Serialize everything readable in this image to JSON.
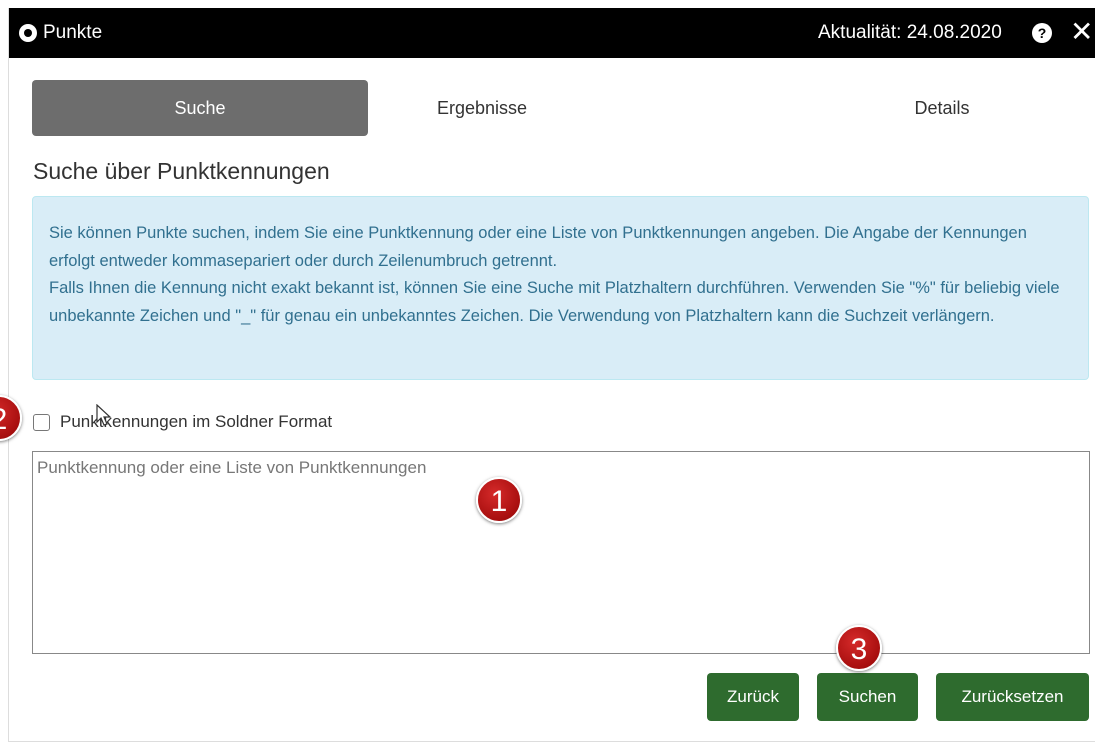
{
  "window": {
    "title": "Punkte",
    "aktualitaet": "Aktualität: 24.08.2020",
    "help_icon": "?",
    "close_icon": "✕"
  },
  "tabs": [
    {
      "label": "Suche",
      "active": true
    },
    {
      "label": "Ergebnisse",
      "active": false
    },
    {
      "label": "Details",
      "active": false
    }
  ],
  "section_title": "Suche über Punktkennungen",
  "info": {
    "line1": "Sie können Punkte suchen, indem Sie eine Punktkennung oder eine Liste von Punktkennungen angeben. Die Angabe der Kennungen erfolgt entweder kommasepariert oder durch Zeilenumbruch getrennt.",
    "line2": "Falls Ihnen die Kennung nicht exakt bekannt ist, können Sie eine Suche mit Platzhaltern durchführen. Verwenden Sie \"%\" für beliebig viele unbekannte Zeichen und \"_\" für genau ein unbekanntes Zeichen. Die Verwendung von Platzhaltern kann die Suchzeit verlängern."
  },
  "soldner_checkbox": {
    "label": "Punktkennungen im Soldner Format",
    "checked": false
  },
  "input": {
    "placeholder": "Punktkennung oder eine Liste von Punktkennungen",
    "value": ""
  },
  "buttons": {
    "back": "Zurück",
    "search": "Suchen",
    "reset": "Zurücksetzen"
  },
  "markers": [
    "1",
    "2",
    "3"
  ],
  "colors": {
    "titlebar": "#000000",
    "tab_active": "#6d6d6d",
    "info_bg": "#d9edf7",
    "info_text": "#31708f",
    "button": "#2e6b2e",
    "marker": "#b01515"
  }
}
